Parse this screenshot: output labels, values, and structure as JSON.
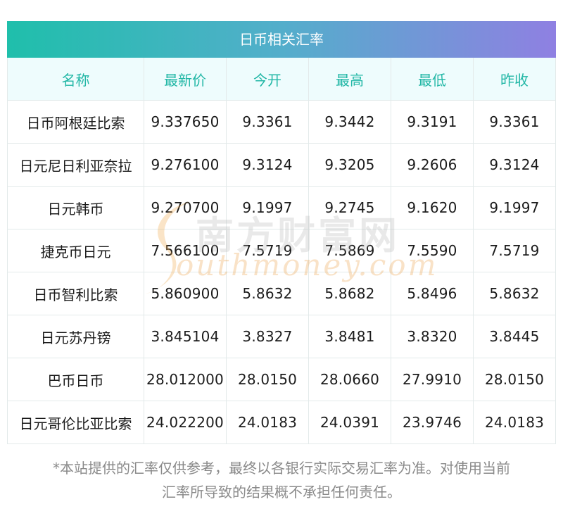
{
  "title": "日币相关汇率",
  "columns": [
    "名称",
    "最新价",
    "今开",
    "最高",
    "最低",
    "昨收"
  ],
  "rows": [
    [
      "日币阿根廷比索",
      "9.337650",
      "9.3361",
      "9.3442",
      "9.3191",
      "9.3361"
    ],
    [
      "日元尼日利亚奈拉",
      "9.276100",
      "9.3124",
      "9.3205",
      "9.2606",
      "9.3124"
    ],
    [
      "日元韩币",
      "9.270700",
      "9.1997",
      "9.2745",
      "9.1620",
      "9.1997"
    ],
    [
      "捷克币日元",
      "7.566100",
      "7.5719",
      "7.5869",
      "7.5590",
      "7.5719"
    ],
    [
      "日币智利比索",
      "5.860900",
      "5.8632",
      "5.8682",
      "5.8496",
      "5.8632"
    ],
    [
      "日元苏丹镑",
      "3.845104",
      "3.8327",
      "3.8481",
      "3.8320",
      "3.8445"
    ],
    [
      "巴币日币",
      "28.012000",
      "28.0150",
      "28.0660",
      "27.9910",
      "28.0150"
    ],
    [
      "日元哥伦比亚比索",
      "24.022200",
      "24.0183",
      "24.0391",
      "23.9746",
      "24.0183"
    ]
  ],
  "watermark": {
    "chinese": "南方财富网",
    "english": "outhmoney.com"
  },
  "disclaimer": {
    "line1": "*本站提供的汇率仅供参考，最终以各银行实际交易汇率为准。对使用当前",
    "line2": "汇率所导致的结果概不承担任何责任。"
  },
  "colors": {
    "header_text": "#22b7a6",
    "header_bg": "#eefcfd",
    "title_gradient_start": "#1fbfab",
    "title_gradient_end": "#8f80e2",
    "disclaimer_text": "#8a8a8a"
  }
}
